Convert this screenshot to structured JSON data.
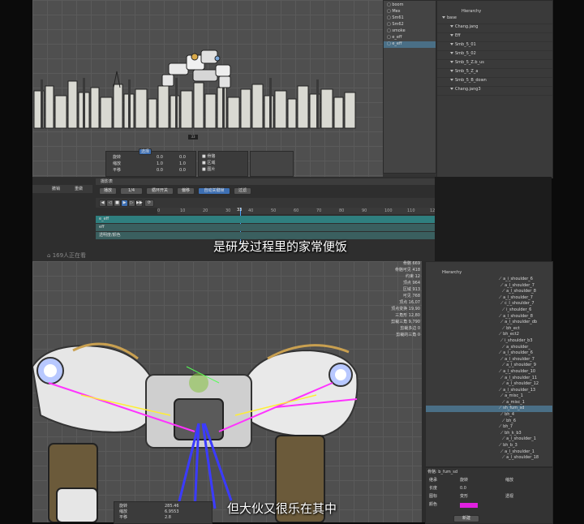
{
  "top_layers": [
    "boom",
    "Mex",
    "Sm61",
    "Sm62",
    "smoke",
    "e_eff",
    "e_eff"
  ],
  "top_hierarchy": [
    "base",
    "Chang.jang",
    "Eff",
    "Smb_5_01",
    "Smb_5_02",
    "Smb_5_Z.b_us",
    "Smb_5_Z_a",
    "Smb_5_B_down",
    "Chang.jang3"
  ],
  "props_panel": {
    "rows": [
      {
        "label": "旋转",
        "v1": "0.0",
        "v2": "0.0"
      },
      {
        "label": "缩放",
        "v1": "1.0",
        "v2": "1.0"
      },
      {
        "label": "平移",
        "v1": "0.0",
        "v2": "0.0"
      }
    ],
    "header": "选择",
    "ops": [
      "骨骼",
      "区域",
      "图片"
    ]
  },
  "timeline": {
    "title": "摄影表",
    "toolbar": [
      "播放",
      "1/4",
      "循环开关",
      "偏移",
      "自动关键帧",
      "过滤"
    ],
    "ticks": [
      "0",
      "10",
      "20",
      "30",
      "40",
      "50",
      "60",
      "70",
      "80",
      "90",
      "100",
      "110",
      "120"
    ],
    "current_frame": "33",
    "tracks": [
      "e_eff",
      "eff",
      "透明度/颜色"
    ],
    "left_tabs": [
      "撤销",
      "重做"
    ],
    "viewer_count": "169人正在看"
  },
  "subtitle_top": "是研发过程里的家常便饭",
  "subtitle_bottom": "但大伙又很乐在其中",
  "stats": [
    {
      "label": "骨骼",
      "value": "669"
    },
    {
      "label": "骨骼可见",
      "value": "418"
    },
    {
      "label": "约束",
      "value": "12"
    },
    {
      "label": "顶点",
      "value": "964"
    },
    {
      "label": "区域",
      "value": "913"
    },
    {
      "label": "可见",
      "value": "768"
    },
    {
      "label": "顶点",
      "value": "16,07"
    },
    {
      "label": "顶点变换",
      "value": "19,90"
    },
    {
      "label": "三角形",
      "value": "12,80"
    },
    {
      "label": "剪裁三角",
      "value": "9,790"
    },
    {
      "label": "剪裁多边",
      "value": "0"
    },
    {
      "label": "剪裁的三角",
      "value": "0"
    }
  ],
  "bottom_hierarchy": [
    "a_i_shoulder_6",
    "a_l_shoulder_7",
    "a_l_shoulder_8",
    "a_l_shoulder_7",
    "c_l_shoulder_7",
    "i_shoulder_6",
    "a_l_shoulder_8",
    "a_l_shoulder_db",
    "bh_ect",
    "bh_ect2",
    "i_shoulder_b3",
    "a_shoulder_",
    "a_l_shoulder_6",
    "a_l_shoulder_7",
    "a_l_shoulder_9",
    "a_l_shoulder_10",
    "a_l_shoulder_11",
    "a_l_shoulder_12",
    "a_l_shoulder_13",
    "a_misc_1",
    "a_misc_1",
    "sh_fum_sd",
    "bh_4",
    "bh_6",
    "bh_7",
    "bh_k_b3",
    "a_l_shoulder_1",
    "bh_b_3",
    "a_l_shoulder_1",
    "a_l_shoulder_18"
  ],
  "bottom_props": {
    "title": "骨骼: b_fum_sd",
    "rows": [
      {
        "label": "继承",
        "a": "旋转",
        "b": "缩放"
      },
      {
        "label": "长度",
        "a": "0.0",
        "b": ""
      },
      {
        "label": "图标",
        "a": "变形",
        "b": "透视"
      },
      {
        "label": "颜色",
        "a": "",
        "b": ""
      }
    ],
    "add_button": "新建"
  },
  "bottom_mini_panel": {
    "values": [
      "285.46",
      "6.9553",
      "2.8"
    ],
    "labels": [
      "旋转",
      "缩放",
      "平移"
    ]
  },
  "bottom_hierarchy_title": "Hierarchy",
  "top_hierarchy_title": "Hierarchy"
}
